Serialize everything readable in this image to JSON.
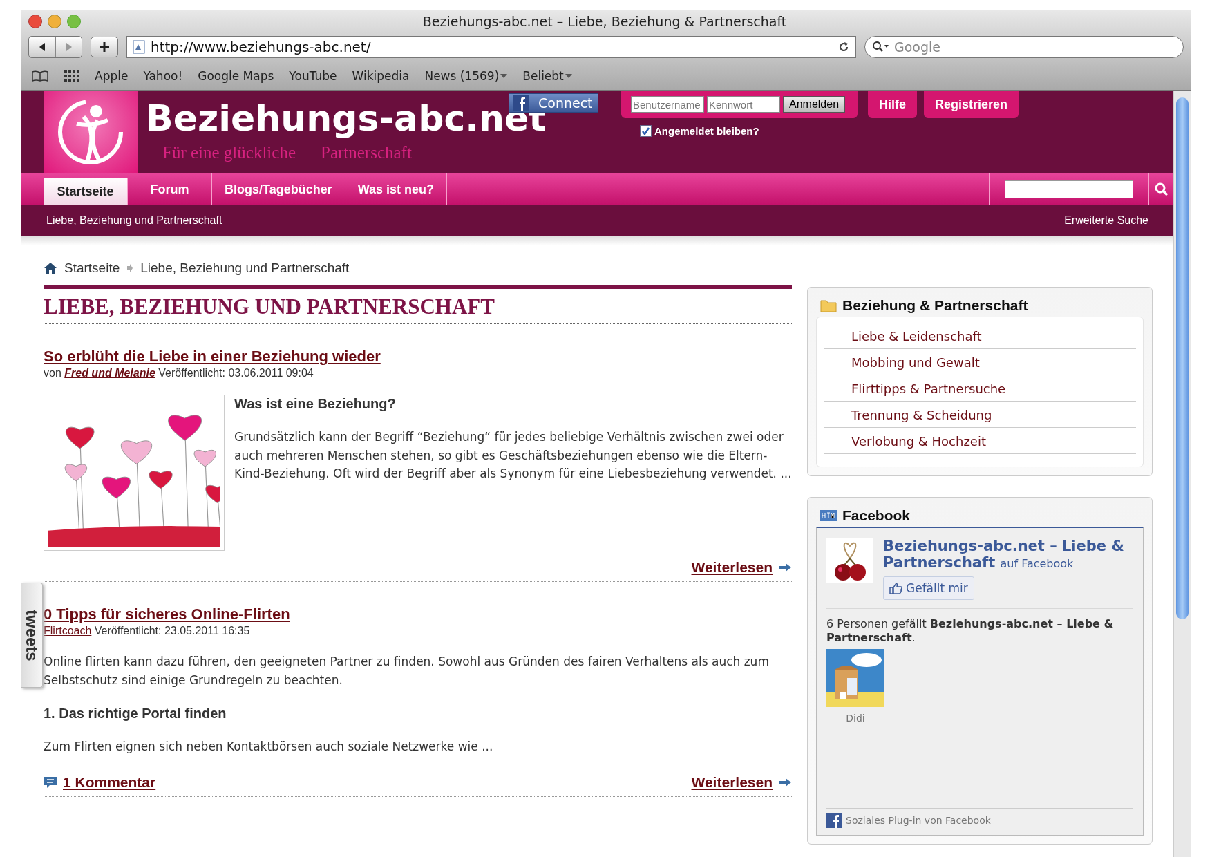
{
  "browser": {
    "title": "Beziehungs-abc.net – Liebe, Beziehung & Partnerschaft",
    "url": "http://www.beziehungs-abc.net/",
    "search_placeholder": "Google",
    "bookmarks": [
      {
        "label": "Apple",
        "menu": false
      },
      {
        "label": "Yahoo!",
        "menu": false
      },
      {
        "label": "Google Maps",
        "menu": false
      },
      {
        "label": "YouTube",
        "menu": false
      },
      {
        "label": "Wikipedia",
        "menu": false
      },
      {
        "label": "News (1569)",
        "menu": true
      },
      {
        "label": "Beliebt",
        "menu": true
      }
    ]
  },
  "header": {
    "site_name": "Beziehungs-abc.net",
    "tagline": [
      "Für eine glückliche",
      "Partnerschaft"
    ],
    "facebook_connect": "Connect",
    "login": {
      "username_placeholder": "Benutzername",
      "password_placeholder": "Kennwort",
      "submit": "Anmelden",
      "remember": {
        "label": "Angemeldet bleiben?",
        "checked": true
      }
    },
    "buttons": [
      "Hilfe",
      "Registrieren"
    ]
  },
  "nav": {
    "tabs": [
      {
        "label": "Startseite",
        "selected": true
      },
      {
        "label": "Forum",
        "selected": false
      },
      {
        "label": "Blogs/Tagebücher",
        "selected": false
      },
      {
        "label": "Was ist neu?",
        "selected": false
      }
    ]
  },
  "subbar": {
    "title": "Liebe, Beziehung und Partnerschaft",
    "advanced_search": "Erweiterte Suche"
  },
  "breadcrumb": [
    "Startseite",
    "Liebe, Beziehung und Partnerschaft"
  ],
  "page_title": "LIEBE, BEZIEHUNG UND PARTNERSCHAFT",
  "articles": [
    {
      "title": "So erblüht die Liebe in einer Beziehung wieder",
      "by_prefix": "von",
      "author": "Fred und Melanie",
      "author_emphasis": true,
      "published": "Veröffentlicht: 03.06.2011 09:04",
      "image": {
        "kind": "picture"
      },
      "blocks": [
        {
          "kind": "heading",
          "text": "Was ist eine Beziehung?"
        },
        {
          "kind": "paragraph",
          "text": "Grundsätzlich kann der Begriff “Beziehung“ für jedes beliebige Verhältnis zwischen zwei oder auch mehreren Menschen stehen, so gibt es Geschäftsbeziehungen ebenso wie die Eltern-Kind-Beziehung. Oft wird der Begriff aber als Synonym für eine Liebesbeziehung verwendet. ..."
        }
      ],
      "read_more": "Weiterlesen"
    },
    {
      "title": "0 Tipps für sicheres Online-Flirten",
      "author": "Flirtcoach",
      "author_emphasis": false,
      "published": "Veröffentlicht: 23.05.2011 16:35",
      "blocks": [
        {
          "kind": "paragraph",
          "text": "Online flirten kann dazu führen, den geeigneten Partner zu finden. Sowohl aus Gründen des fairen Verhaltens als auch zum Selbstschutz sind einige Grundregeln zu beachten."
        },
        {
          "kind": "heading",
          "text": "1. Das richtige Portal finden"
        },
        {
          "kind": "paragraph",
          "text": "Zum Flirten eignen sich neben Kontaktbörsen auch soziale Netzwerke wie ..."
        }
      ],
      "comments": "1 Kommentar",
      "read_more": "Weiterlesen"
    }
  ],
  "tweets_tab": "tweets",
  "sidebar": {
    "category_box": {
      "title": "Beziehung & Partnerschaft",
      "items": [
        "Liebe & Leidenschaft",
        "Mobbing und Gewalt",
        "Flirttipps & Partnersuche",
        "Trennung & Scheidung",
        "Verlobung & Hochzeit"
      ]
    },
    "facebook": {
      "title": "Facebook",
      "page_name": "Beziehungs-abc.net – Liebe & Partnerschaft",
      "page_suffix": "auf Facebook",
      "like_button": "Gefällt mir",
      "fans_text": "6 Personen gefällt **Beziehungs-abc.net – Liebe & Partnerschaft**.",
      "fans": [
        {
          "name": "Didi"
        }
      ],
      "footer": "Soziales Plug-in von Facebook"
    }
  }
}
